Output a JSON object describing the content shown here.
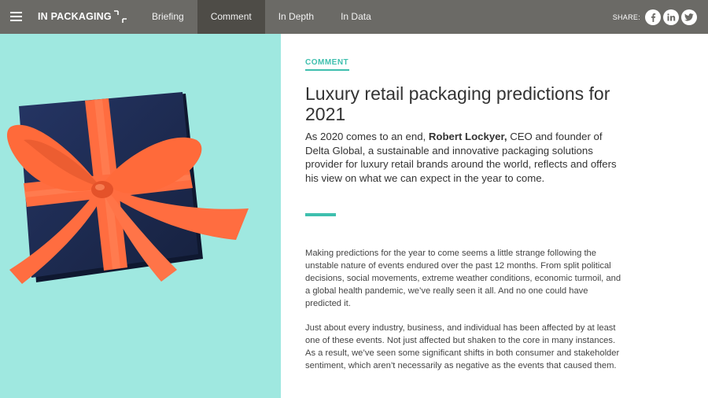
{
  "header": {
    "logo_text": "IN PACKAGING",
    "nav": [
      {
        "label": "Briefing",
        "active": false
      },
      {
        "label": "Comment",
        "active": true
      },
      {
        "label": "In Depth",
        "active": false
      },
      {
        "label": "In Data",
        "active": false
      }
    ],
    "share_label": "SHARE:",
    "share_icons": [
      "facebook-icon",
      "linkedin-icon",
      "twitter-icon"
    ]
  },
  "article": {
    "category": "COMMENT",
    "title": "Luxury retail packaging predictions for 2021",
    "standfirst_pre": "As 2020 comes to an end, ",
    "standfirst_name": "Robert Lockyer,",
    "standfirst_post": " CEO and founder of Delta Global, a sustainable and innovative packaging solutions provider for luxury retail brands around the world, reflects and offers his view on what we can expect in the year to come.",
    "paragraphs": [
      "Making predictions for the year to come seems a little strange following the unstable nature of events endured over the past 12 months. From split political decisions, social movements, extreme weather conditions, economic turmoil, and a global health pandemic, we’ve really seen it all. And no one could have predicted it.",
      "Just about every industry, business, and individual has been affected by at least one of these events. Not just affected but shaken to the core in many instances. As a result, we’ve seen some significant shifts in both consumer and stakeholder sentiment, which aren’t necessarily as negative as the events that caused them."
    ]
  },
  "colors": {
    "topbar": "#6b6a66",
    "active_nav": "#4e4c47",
    "accent": "#3ebfae",
    "hero_bg": "#9fe8e0",
    "gift_box": "#1f2d55",
    "ribbon": "#ff6a3d"
  }
}
